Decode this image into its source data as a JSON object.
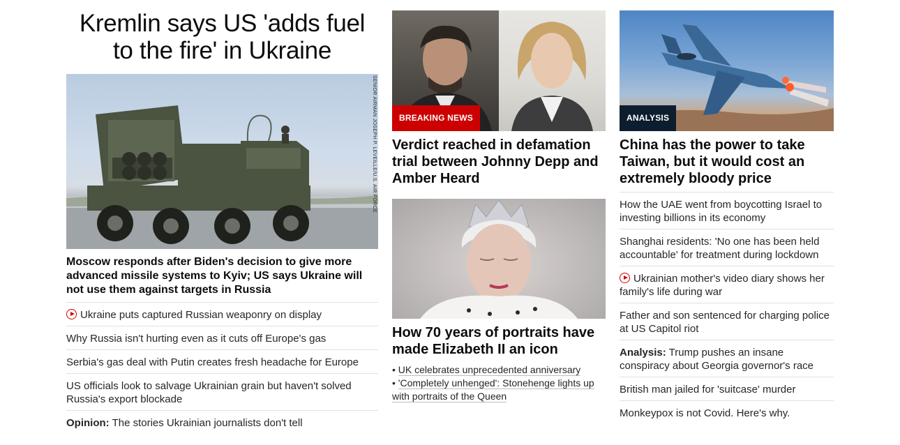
{
  "left": {
    "headline": "Kremlin says US 'adds fuel to the fire' in Ukraine",
    "photo_credit": "SENIOR AIRMAN JOSEPH P. LEVEILLE/U.S. AIR FORCE",
    "summary": "Moscow responds after Biden's decision to give more advanced missile systems to Kyiv; US says Ukraine will not use them against targets in Russia",
    "links": [
      {
        "text": "Ukraine puts captured Russian weaponry on display",
        "video": true
      },
      {
        "text": "Why Russia isn't hurting even as it cuts off Europe's gas"
      },
      {
        "text": "Serbia's gas deal with Putin creates fresh headache for Europe"
      },
      {
        "text": "US officials look to salvage Ukrainian grain but haven't solved Russia's export blockade"
      },
      {
        "label": "Opinion:",
        "text": "The stories Ukrainian journalists don't tell"
      }
    ]
  },
  "middle": {
    "card1": {
      "badge": "BREAKING NEWS",
      "title": "Verdict reached in defamation trial between Johnny Depp and Amber Heard"
    },
    "card2": {
      "title": "How 70 years of portraits have made Elizabeth II an icon",
      "bullets": [
        "UK celebrates unprecedented anniversary",
        "'Completely unhenged': Stonehenge lights up with portraits of the Queen"
      ]
    }
  },
  "right": {
    "badge": "ANALYSIS",
    "title": "China has the power to take Taiwan, but it would cost an extremely bloody price",
    "links": [
      {
        "text": "How the UAE went from boycotting Israel to investing billions in its economy"
      },
      {
        "text": "Shanghai residents: 'No one has been held accountable' for treatment during lockdown"
      },
      {
        "text": "Ukrainian mother's video diary shows her family's life during war",
        "video": true
      },
      {
        "text": "Father and son sentenced for charging police at US Capitol riot"
      },
      {
        "label": "Analysis:",
        "text": "Trump pushes an insane conspiracy about Georgia governor's race"
      },
      {
        "text": "British man jailed for 'suitcase' murder"
      },
      {
        "text": "Monkeypox is not Covid. Here's why."
      }
    ]
  },
  "colors": {
    "breaking_red": "#cc0000",
    "analysis_navy": "#0c1d2e",
    "divider": "#e1e1e1"
  }
}
